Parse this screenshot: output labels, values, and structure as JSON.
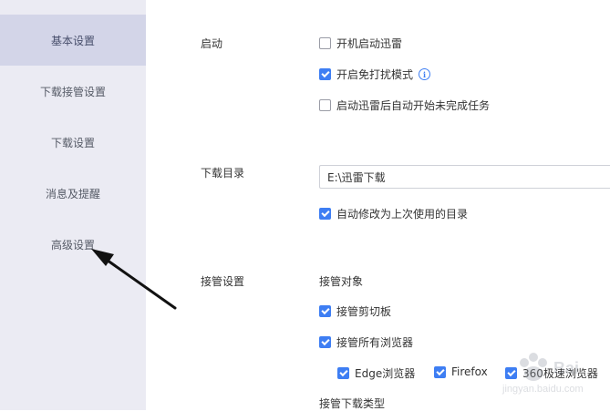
{
  "sidebar": {
    "items": [
      {
        "label": "基本设置",
        "active": true
      },
      {
        "label": "下载接管设置",
        "active": false
      },
      {
        "label": "下载设置",
        "active": false
      },
      {
        "label": "消息及提醒",
        "active": false
      },
      {
        "label": "高级设置",
        "active": false
      }
    ]
  },
  "startup": {
    "label": "启动",
    "options": [
      {
        "label": "开机启动迅雷",
        "checked": false
      },
      {
        "label": "开启免打扰模式",
        "checked": true
      },
      {
        "label": "启动迅雷后自动开始未完成任务",
        "checked": false
      }
    ]
  },
  "download_dir": {
    "label": "下载目录",
    "value": "E:\\迅雷下载",
    "auto_modify": {
      "label": "自动修改为上次使用的目录",
      "checked": true
    }
  },
  "takeover": {
    "label": "接管设置",
    "objects_heading": "接管对象",
    "clipboard": {
      "label": "接管剪切板",
      "checked": true
    },
    "all_browsers": {
      "label": "接管所有浏览器",
      "checked": true
    },
    "browsers": [
      {
        "label": "Edge浏览器",
        "checked": true
      },
      {
        "label": "Firefox",
        "checked": true
      },
      {
        "label": "360极速浏览器",
        "checked": true
      }
    ],
    "types_heading": "接管下载类型"
  },
  "colors": {
    "accent": "#3e7ef3",
    "sidebar_bg": "#ebebf3",
    "sidebar_active": "#d3d5e8"
  }
}
